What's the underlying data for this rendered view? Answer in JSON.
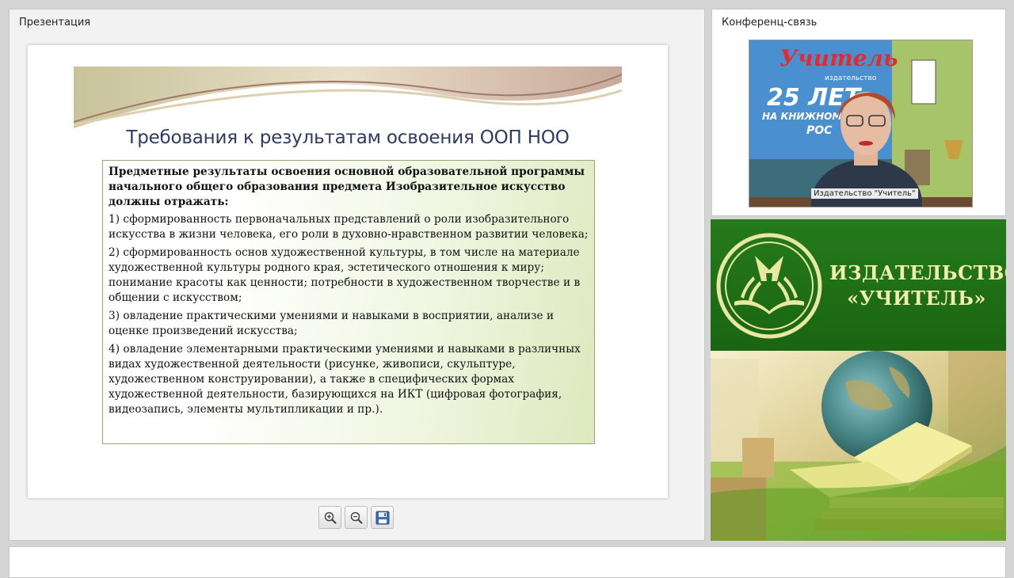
{
  "presentation": {
    "panel_title": "Презентация",
    "slide": {
      "title": "Требования к результатам освоения ООП НОО",
      "lead": "Предметные результаты освоения основной образовательной программы начального общего образования  предмета Изобразительное искусство должны отражать:",
      "items": [
        "1) сформированность первоначальных представлений о роли изобразительного искусства в жизни человека, его роли в духовно-нравственном развитии человека;",
        "2) сформированность основ художественной культуры, в том числе на материале художественной культуры родного края, эстетического отношения к миру; понимание красоты как ценности; потребности в художественном творчестве и в общении с искусством;",
        "3) овладение практическими умениями и навыками в восприятии, анализе и оценке произведений искусства;",
        "4) овладение элементарными практическими умениями и навыками в различных видах художественной деятельности (рисунке, живописи, скульптуре, художественном конструировании), а также в специфических формах художественной деятельности, базирующихся на ИКТ (цифровая фотография, видеозапись, элементы мультипликации и пр.)."
      ]
    },
    "toolbar": {
      "zoom_in_icon": "zoom-in-icon",
      "zoom_out_icon": "zoom-out-icon",
      "save_icon": "floppy-disk-icon"
    }
  },
  "conference": {
    "panel_title": "Конференц-связь",
    "participant_label": "Издательство \"Учитель\"",
    "video_backdrop_text": {
      "line1": "Учитель",
      "line2": "издательство",
      "line3": "25 ЛЕТ",
      "line4": "НА КНИЖНОМ",
      "line5": "РОС"
    }
  },
  "publisher_ad": {
    "name_line1": "ИЗДАТЕЛЬСТВО",
    "name_line2": "«УЧИТЕЛЬ»",
    "colors": {
      "green": "#1e6e16",
      "text": "#f0f0a8"
    }
  }
}
